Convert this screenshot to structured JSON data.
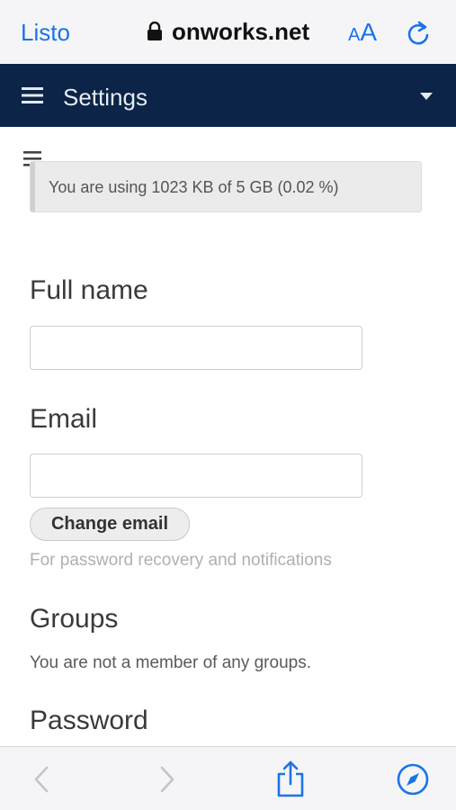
{
  "browser": {
    "done_label": "Listo",
    "url": "onworks.net",
    "text_size_small": "A",
    "text_size_big": "A",
    "accent_color": "#1a73e8"
  },
  "app_header": {
    "title": "Settings",
    "background": "#0b2447"
  },
  "quota": {
    "text": "You are using 1023 KB of 5 GB (0.02 %)",
    "used_percent": 0.02
  },
  "form": {
    "full_name": {
      "label": "Full name",
      "value": ""
    },
    "email": {
      "label": "Email",
      "value": "",
      "change_button": "Change email",
      "hint": "For password recovery and notifications"
    },
    "groups": {
      "label": "Groups",
      "text": "You are not a member of any groups."
    },
    "password": {
      "label": "Password"
    }
  },
  "icons": {
    "lock": "lock-icon",
    "reload": "reload-icon",
    "menu": "hamburger-icon",
    "caret": "chevron-down-icon",
    "back": "chevron-left-icon",
    "forward": "chevron-right-icon",
    "share": "share-icon",
    "compass": "compass-icon"
  }
}
